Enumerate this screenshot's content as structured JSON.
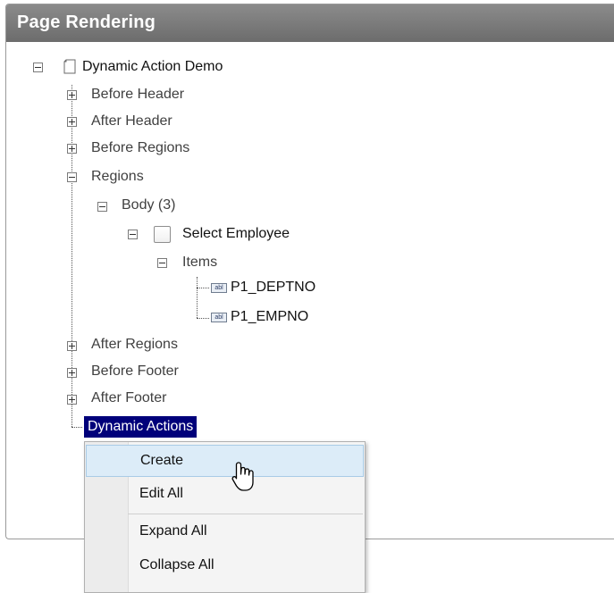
{
  "panel": {
    "title": "Page Rendering"
  },
  "tree": {
    "root": "Dynamic Action Demo",
    "nodes": {
      "before_header": "Before Header",
      "after_header": "After Header",
      "before_regions": "Before Regions",
      "regions": "Regions",
      "body": "Body (3)",
      "select_employee": "Select Employee",
      "items": "Items",
      "p1_deptno": "P1_DEPTNO",
      "p1_empno": "P1_EMPNO",
      "after_regions": "After Regions",
      "before_footer": "Before Footer",
      "after_footer": "After Footer",
      "dynamic_actions": "Dynamic Actions"
    },
    "item_icon_text": "abl"
  },
  "context_menu": {
    "items": [
      "Create",
      "Edit All",
      "Expand All",
      "Collapse All"
    ],
    "hovered": "Create"
  },
  "icons": {
    "page": "page-icon",
    "region": "region-icon",
    "item": "text-item-icon",
    "cursor": "hand-pointer-icon"
  },
  "colors": {
    "header_bg": "#7a7a7a",
    "selection_bg": "#00007a",
    "menu_hover": "#dcecf8"
  }
}
